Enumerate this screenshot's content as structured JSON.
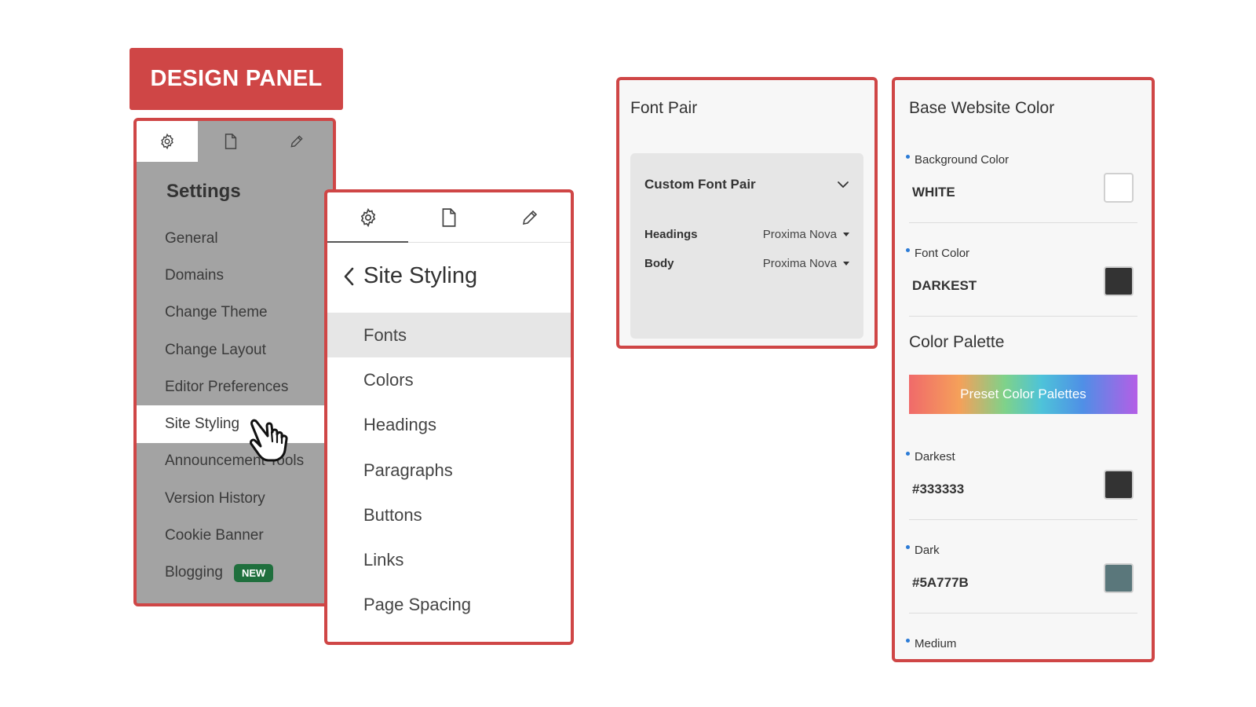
{
  "banner": {
    "title": "DESIGN PANEL"
  },
  "settings_panel": {
    "tabs": [
      "gear-icon",
      "page-icon",
      "pencil-icon"
    ],
    "title": "Settings",
    "items": [
      {
        "label": "General"
      },
      {
        "label": "Domains"
      },
      {
        "label": "Change Theme"
      },
      {
        "label": "Change Layout"
      },
      {
        "label": "Editor Preferences"
      },
      {
        "label": "Site Styling",
        "active": true
      },
      {
        "label": "Announcement Tools"
      },
      {
        "label": "Version History"
      },
      {
        "label": "Cookie Banner"
      },
      {
        "label": "Blogging",
        "badge": "NEW"
      }
    ]
  },
  "styling_panel": {
    "back_label": "Site Styling",
    "items": [
      {
        "label": "Fonts",
        "active": true
      },
      {
        "label": "Colors"
      },
      {
        "label": "Headings"
      },
      {
        "label": "Paragraphs"
      },
      {
        "label": "Buttons"
      },
      {
        "label": "Links"
      },
      {
        "label": "Page Spacing"
      }
    ]
  },
  "font_pair_panel": {
    "title": "Font Pair",
    "selector_label": "Custom Font Pair",
    "rows": [
      {
        "label": "Headings",
        "value": "Proxima Nova"
      },
      {
        "label": "Body",
        "value": "Proxima Nova"
      }
    ]
  },
  "color_panel": {
    "title": "Base Website Color",
    "background": {
      "label": "Background Color",
      "value": "WHITE",
      "color": "#ffffff"
    },
    "font": {
      "label": "Font Color",
      "value": "DARKEST",
      "color": "#333333"
    },
    "palette_title": "Color Palette",
    "palette_button": "Preset Color Palettes",
    "palette": [
      {
        "label": "Darkest",
        "value": "#333333",
        "color": "#333333"
      },
      {
        "label": "Dark",
        "value": "#5A777B",
        "color": "#5a777b"
      },
      {
        "label": "Medium"
      }
    ]
  },
  "colors": {
    "accent": "#cf4646",
    "badge": "#1f6f3d",
    "bullet": "#2b7bd6"
  }
}
